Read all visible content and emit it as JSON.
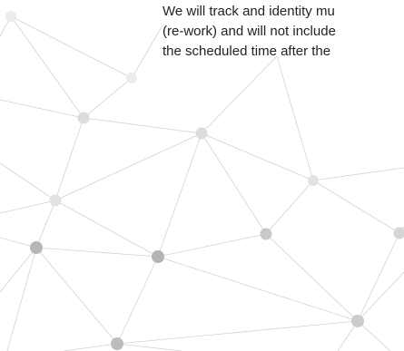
{
  "document": {
    "lines": [
      "We will track and identity mu",
      "(re-work) and will not include",
      "the scheduled time after the"
    ]
  },
  "decoration": {
    "name": "network-graph-background",
    "line_color": "#d2d2d2",
    "node_colors": {
      "light": "#ececec",
      "medium": "#d6d6d6",
      "dark": "#b6b6b6"
    }
  }
}
